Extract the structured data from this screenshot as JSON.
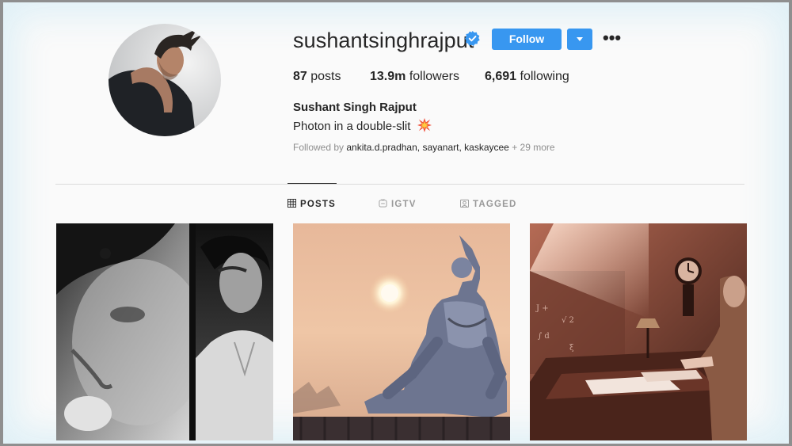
{
  "profile": {
    "username": "sushantsinghrajput",
    "verified_icon": "verified-badge-icon",
    "follow_label": "Follow",
    "full_name": "Sushant Singh Rajput",
    "bio": "Photon in a double-slit",
    "bio_emoji": "collision-emoji",
    "followed_by_prefix": "Followed by",
    "followed_by_users": "ankita.d.pradhan, sayanart, kaskaycee",
    "followed_by_more": "+ 29 more"
  },
  "stats": {
    "posts_count": "87",
    "posts_label": "posts",
    "followers_count": "13.9m",
    "followers_label": "followers",
    "following_count": "6,691",
    "following_label": "following"
  },
  "tabs": [
    {
      "label": "POSTS",
      "icon": "grid-icon",
      "active": true
    },
    {
      "label": "IGTV",
      "icon": "igtv-icon",
      "active": false
    },
    {
      "label": "TAGGED",
      "icon": "tagged-icon",
      "active": false
    }
  ],
  "posts": [
    {
      "subject": "black-and-white portraits collage"
    },
    {
      "subject": "shiva statue at sunset"
    },
    {
      "subject": "man at desk in sepia room"
    }
  ],
  "colors": {
    "accent": "#3897f0",
    "verified": "#3897f0",
    "muted_text": "#8e8e8e",
    "divider": "#dbdbdb"
  }
}
